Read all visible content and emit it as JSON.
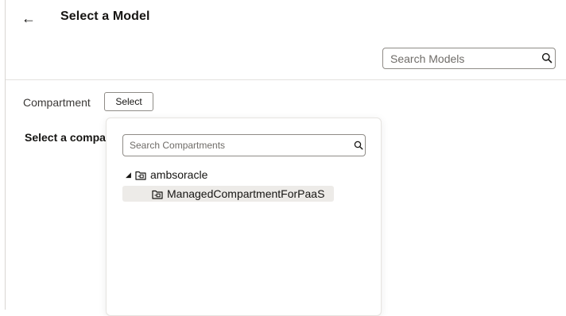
{
  "header": {
    "title": "Select a Model",
    "back_icon": "arrow-left-icon"
  },
  "search_models": {
    "placeholder": "Search Models",
    "value": "",
    "icon": "search-icon"
  },
  "compartment": {
    "label": "Compartment",
    "select_button": "Select"
  },
  "hint_text": "Select a compa",
  "compartment_popup": {
    "search_placeholder": "Search Compartments",
    "search_value": "",
    "tree": [
      {
        "label": "ambsoracle",
        "expanded": true,
        "icon": "compartment-folder-icon",
        "children": [
          {
            "label": "ManagedCompartmentForPaaS",
            "icon": "compartment-folder-icon",
            "highlighted": true
          }
        ]
      }
    ]
  },
  "colors": {
    "text": "#161513",
    "border": "#8f8c87",
    "divider": "#e4e2de",
    "highlight": "#edebe8",
    "placeholder": "#6f6c68"
  }
}
